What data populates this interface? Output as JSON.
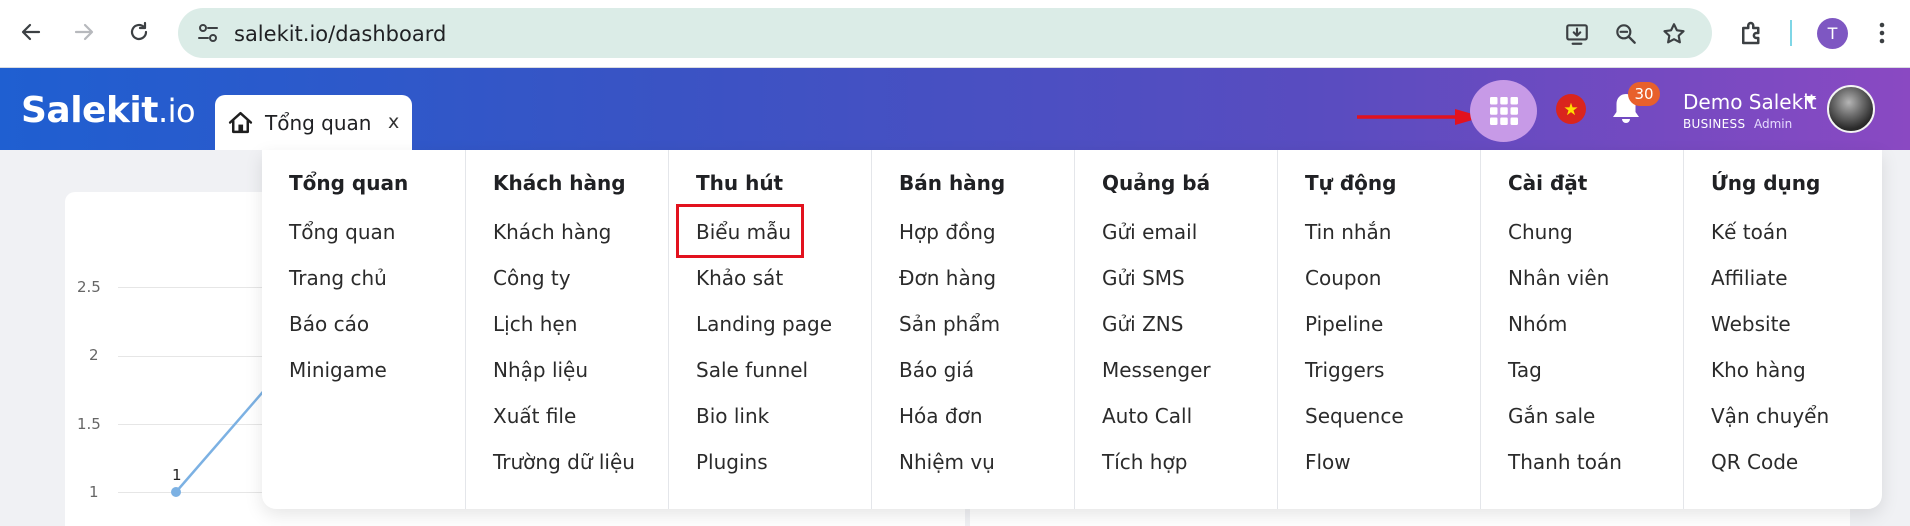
{
  "browser": {
    "url": "salekit.io/dashboard",
    "profile_initial": "T"
  },
  "header": {
    "logo_main": "Salekit",
    "logo_suffix": ".io",
    "tab_label": "Tổng quan",
    "tab_close": "x",
    "notification_count": "30",
    "user_name": "Demo Salekit",
    "user_plan": "BUSINESS",
    "user_role": "Admin",
    "apps_button_color": "#c79ae7",
    "arrow_color": "#e2121e"
  },
  "chart": {
    "y_ticks": [
      "2.5",
      "2",
      "1.5",
      "1"
    ],
    "point_label": "1"
  },
  "menu": {
    "columns": [
      {
        "title": "Tổng quan",
        "items": [
          "Tổng quan",
          "Trang chủ",
          "Báo cáo",
          "Minigame"
        ]
      },
      {
        "title": "Khách hàng",
        "items": [
          "Khách hàng",
          "Công ty",
          "Lịch hẹn",
          "Nhập liệu",
          "Xuất file",
          "Trường dữ liệu"
        ]
      },
      {
        "title": "Thu hút",
        "items": [
          "Biểu mẫu",
          "Khảo sát",
          "Landing page",
          "Sale funnel",
          "Bio link",
          "Plugins"
        ]
      },
      {
        "title": "Bán hàng",
        "items": [
          "Hợp đồng",
          "Đơn hàng",
          "Sản phẩm",
          "Báo giá",
          "Hóa đơn",
          "Nhiệm vụ"
        ]
      },
      {
        "title": "Quảng bá",
        "items": [
          "Gửi email",
          "Gửi SMS",
          "Gửi ZNS",
          "Messenger",
          "Auto Call",
          "Tích hợp"
        ]
      },
      {
        "title": "Tự động",
        "items": [
          "Tin nhắn",
          "Coupon",
          "Pipeline",
          "Triggers",
          "Sequence",
          "Flow"
        ]
      },
      {
        "title": "Cài đặt",
        "items": [
          "Chung",
          "Nhân viên",
          "Nhóm",
          "Tag",
          "Gắn sale",
          "Thanh toán"
        ]
      },
      {
        "title": "Ứng dụng",
        "items": [
          "Kế toán",
          "Affiliate",
          "Website",
          "Kho hàng",
          "Vận chuyển",
          "QR Code"
        ]
      }
    ],
    "highlight_color": "#e2121e"
  }
}
